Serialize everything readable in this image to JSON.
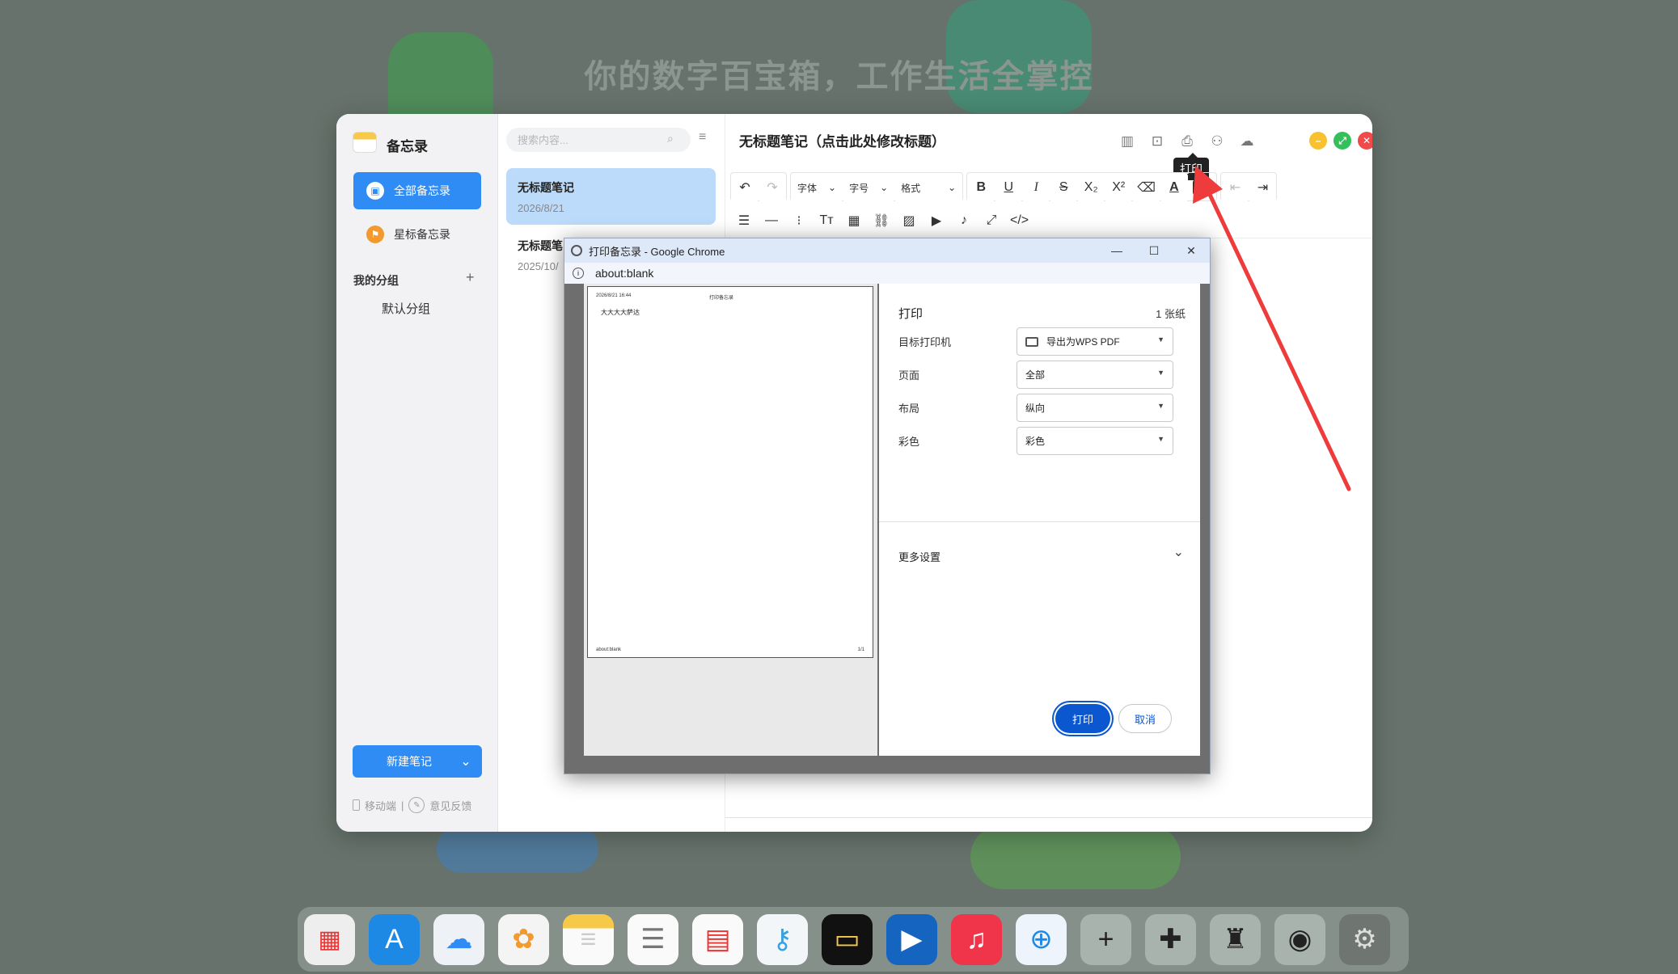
{
  "desktop": {
    "slogan": "你的数字百宝箱，工作生活全掌控"
  },
  "sidebar": {
    "app_name": "备忘录",
    "nav_all": "全部备忘录",
    "nav_star": "星标备忘录",
    "group_head": "我的分组",
    "group_add": "+",
    "group_item": "默认分组",
    "new_note": "新建笔记",
    "mobile": "移动端",
    "separator": "|",
    "feedback": "意见反馈"
  },
  "notelist": {
    "search_placeholder": "搜索内容...",
    "items": [
      {
        "title": "无标题笔记",
        "date": "2026/8/21"
      },
      {
        "title": "无标题笔",
        "date": "2025/10/"
      }
    ]
  },
  "editor": {
    "title": "无标题笔记（点击此处修改标题）",
    "tooltip": "打印",
    "font_select": "字体",
    "size_select": "字号",
    "format_select": "格式"
  },
  "dialog": {
    "window_title": "打印备忘录 - Google Chrome",
    "address": "about:blank",
    "preview": {
      "header_left": "2026/8/21 16:44",
      "header_center": "打印备忘录",
      "body": "大大大大萨达",
      "footer_left": "about:blank",
      "footer_right": "1/1"
    },
    "settings": {
      "title": "打印",
      "sheets": "1 张纸",
      "printer_label": "目标打印机",
      "printer_value": "导出为WPS PDF",
      "pages_label": "页面",
      "pages_value": "全部",
      "layout_label": "布局",
      "layout_value": "纵向",
      "color_label": "彩色",
      "color_value": "彩色",
      "more_settings": "更多设置",
      "print_button": "打印",
      "cancel_button": "取消"
    }
  },
  "colors": {
    "accent": "#2f8cf5",
    "chrome_blue": "#0b57d0",
    "annotation_red": "#ee3b3b"
  }
}
